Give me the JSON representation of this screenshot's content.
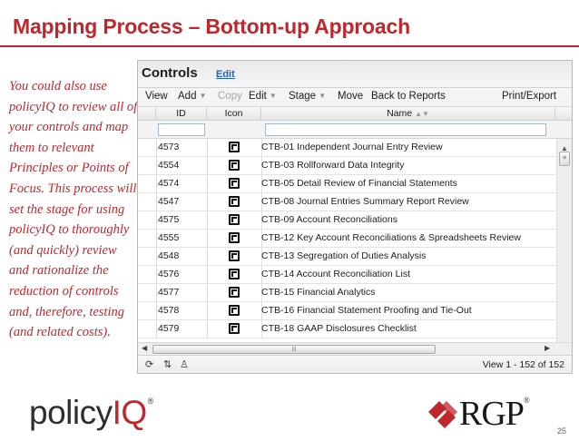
{
  "slide": {
    "title": "Mapping Process – Bottom-up Approach",
    "body": "You could also use policyIQ to review all of your controls and map them to relevant Principles or Points of Focus. This process will set the stage for using policyIQ to thoroughly (and quickly) review and rationalize the reduction of controls and, therefore, testing (and related costs).",
    "page_number": "25",
    "accent_color": "#c0272d"
  },
  "panel": {
    "title": "Controls",
    "edit_link": "Edit",
    "toolbar": {
      "view": "View",
      "add": "Add",
      "copy": "Copy",
      "edit": "Edit",
      "stage": "Stage",
      "move": "Move",
      "back_to_reports": "Back to Reports",
      "print_export": "Print/Export"
    },
    "columns": {
      "id": "ID",
      "icon": "Icon",
      "name": "Name"
    },
    "rows": [
      {
        "id": "4573",
        "name": "CTB-01 Independent Journal Entry Review",
        "icon": "control-icon"
      },
      {
        "id": "4554",
        "name": "CTB-03 Rollforward Data Integrity",
        "icon": "control-icon"
      },
      {
        "id": "4574",
        "name": "CTB-05 Detail Review of Financial Statements",
        "icon": "control-icon"
      },
      {
        "id": "4547",
        "name": "CTB-08 Journal Entries Summary Report Review",
        "icon": "control-icon"
      },
      {
        "id": "4575",
        "name": "CTB-09 Account Reconciliations",
        "icon": "control-icon"
      },
      {
        "id": "4555",
        "name": "CTB-12 Key Account Reconciliations & Spreadsheets Review",
        "icon": "control-icon"
      },
      {
        "id": "4548",
        "name": "CTB-13 Segregation of Duties Analysis",
        "icon": "control-icon"
      },
      {
        "id": "4576",
        "name": "CTB-14 Account Reconciliation List",
        "icon": "control-icon"
      },
      {
        "id": "4577",
        "name": "CTB-15 Financial Analytics",
        "icon": "control-icon"
      },
      {
        "id": "4578",
        "name": "CTB-16 Financial Statement Proofing and Tie-Out",
        "icon": "control-icon"
      },
      {
        "id": "4579",
        "name": "CTB-18 GAAP Disclosures Checklist",
        "icon": "control-icon"
      }
    ],
    "pager_text": "View 1 - 152 of 152"
  },
  "logos": {
    "policyiq_a": "policy",
    "policyiq_b": "IQ",
    "rgp": "RGP"
  }
}
